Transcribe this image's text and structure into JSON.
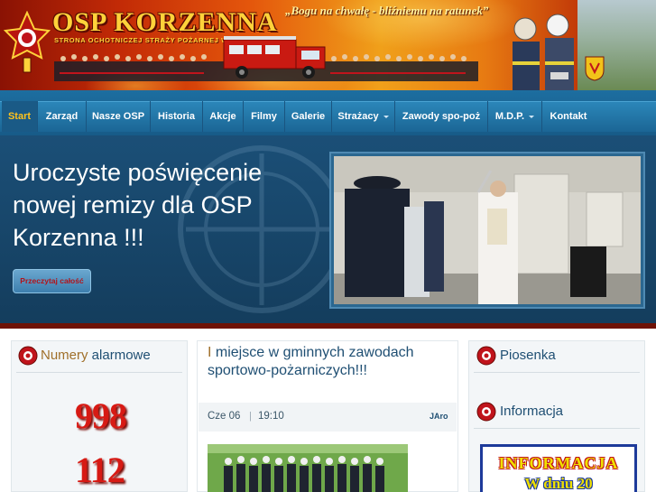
{
  "header": {
    "title": "OSP KORZENNA",
    "subtitle": "STRONA OCHOTNICZEJ STRAŻY POŻARNEJ W KORZENNEJ",
    "motto": "„Bogu na chwałę - bliźniemu na ratunek”"
  },
  "nav": {
    "items": [
      {
        "label": "Start",
        "active": true
      },
      {
        "label": "Zarząd"
      },
      {
        "label": "Nasze OSP"
      },
      {
        "label": "Historia"
      },
      {
        "label": "Akcje"
      },
      {
        "label": "Filmy"
      },
      {
        "label": "Galerie"
      },
      {
        "label": "Strażacy",
        "dropdown": true
      },
      {
        "label": "Zawody spo-poż"
      },
      {
        "label": "M.D.P.",
        "dropdown": true
      },
      {
        "label": "Kontakt"
      }
    ]
  },
  "slideshow": {
    "title": "Uroczyste poświęcenie nowej remizy dla OSP Korzenna !!!",
    "read_more": "Przeczytaj całość"
  },
  "left_box": {
    "title_accent": "Numery",
    "title_rest": " alarmowe",
    "numbers": [
      "998",
      "112"
    ]
  },
  "article": {
    "title_accent": "I",
    "title_rest": " miejsce w gminnych zawodach sportowo-pożarniczych!!!",
    "date": "Cze 06",
    "separator": "|",
    "time": "19:10",
    "author": "JAro"
  },
  "right_box": {
    "song_title": "Piosenka",
    "info_title": "Informacja",
    "banner_line1": "INFORMACJA",
    "banner_line2": "W dniu 20"
  },
  "colors": {
    "nav_bg": "#1b6695",
    "nav_active_text": "#ffc21c",
    "slide_bg": "#143d5d",
    "heading_blue": "#1f4f73",
    "heading_accent": "#a0702a",
    "emergency_red": "#d71a14"
  }
}
